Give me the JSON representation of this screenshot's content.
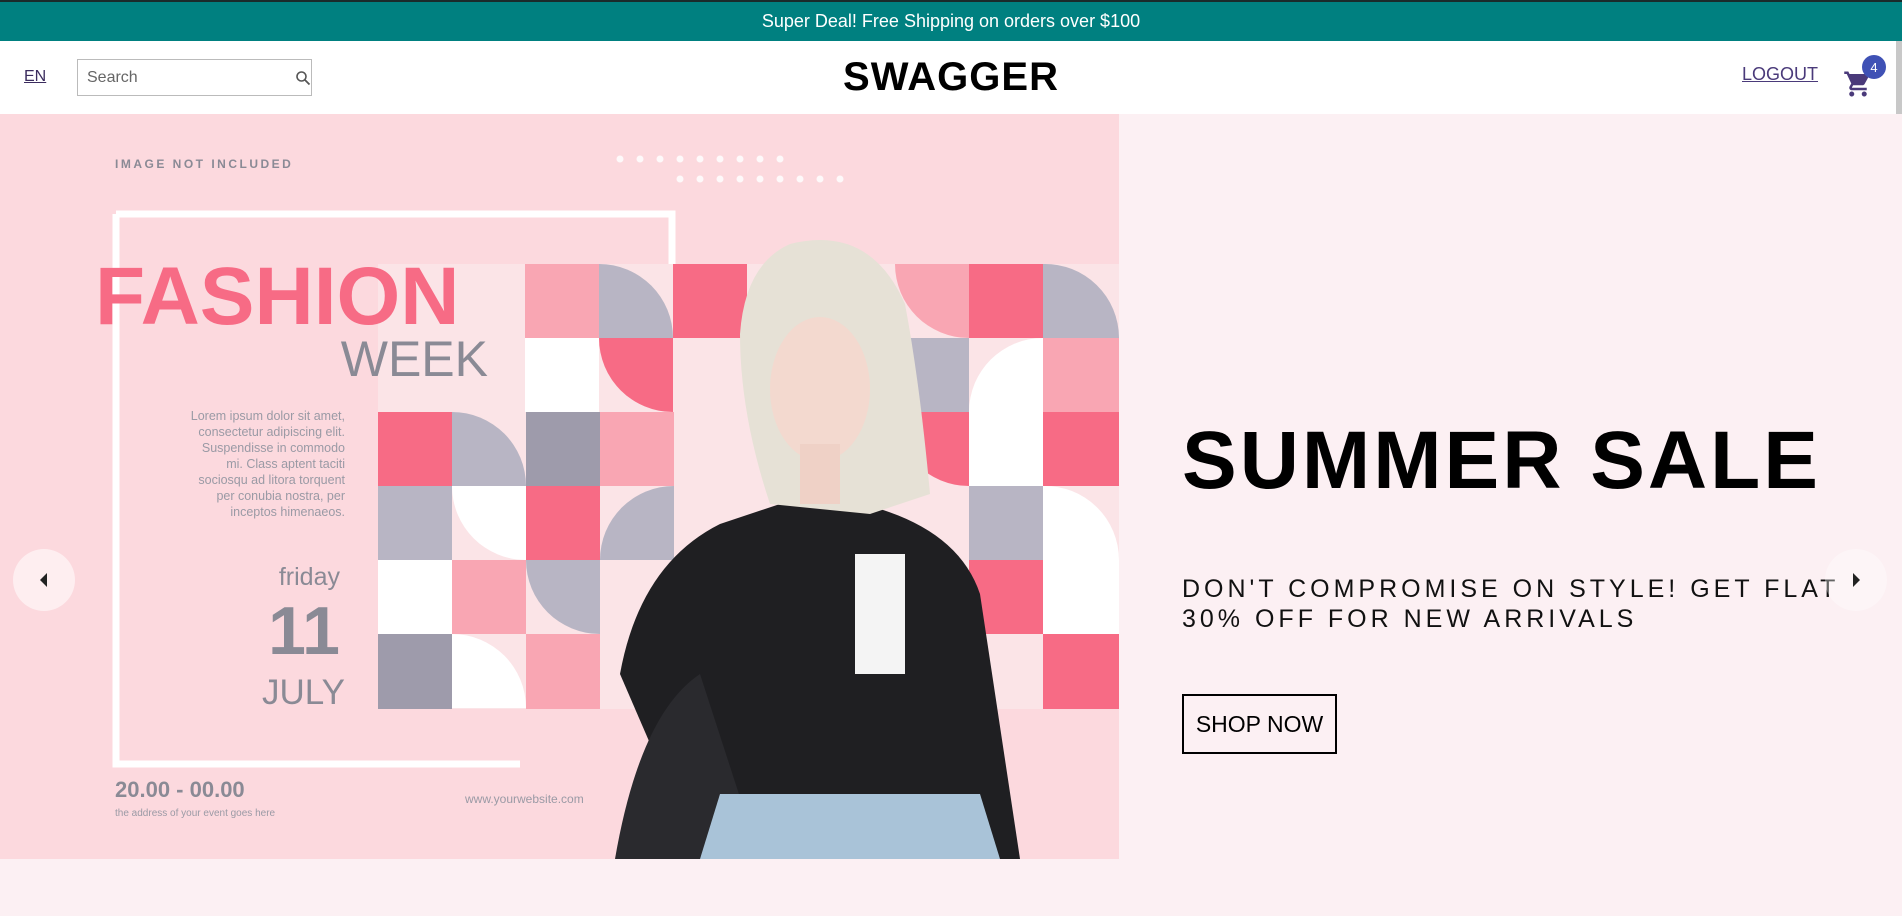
{
  "announcement": {
    "text": "Super Deal! Free Shipping on orders over $100"
  },
  "header": {
    "language": "EN",
    "search_placeholder": "Search",
    "logo": "SWAGGER",
    "logout_label": "LOGOUT",
    "cart_count": "4"
  },
  "banner": {
    "disclaimer": "IMAGE NOT INCLUDED",
    "title_main": "FASHION",
    "title_sub": "WEEK",
    "body_lines": [
      "Lorem ipsum dolor sit amet,",
      "consectetur adipiscing elit.",
      "Suspendisse in commodo",
      "mi. Class aptent taciti",
      "sociosqu ad litora torquent",
      "per conubia nostra, per",
      "inceptos himenaeos."
    ],
    "day": "friday",
    "date": "11",
    "month": "JULY",
    "time": "20.00 - 00.00",
    "address": "the address of your event goes here",
    "website": "www.yourwebsite.com"
  },
  "slide": {
    "title": "SUMMER SALE",
    "description": "DON'T COMPROMISE ON STYLE! GET FLAT 30% OFF FOR NEW ARRIVALS",
    "cta_label": "SHOP NOW"
  },
  "colors": {
    "announcement_bg": "#008080",
    "banner_pink": "#f76b85",
    "badge": "#3f51b5"
  }
}
